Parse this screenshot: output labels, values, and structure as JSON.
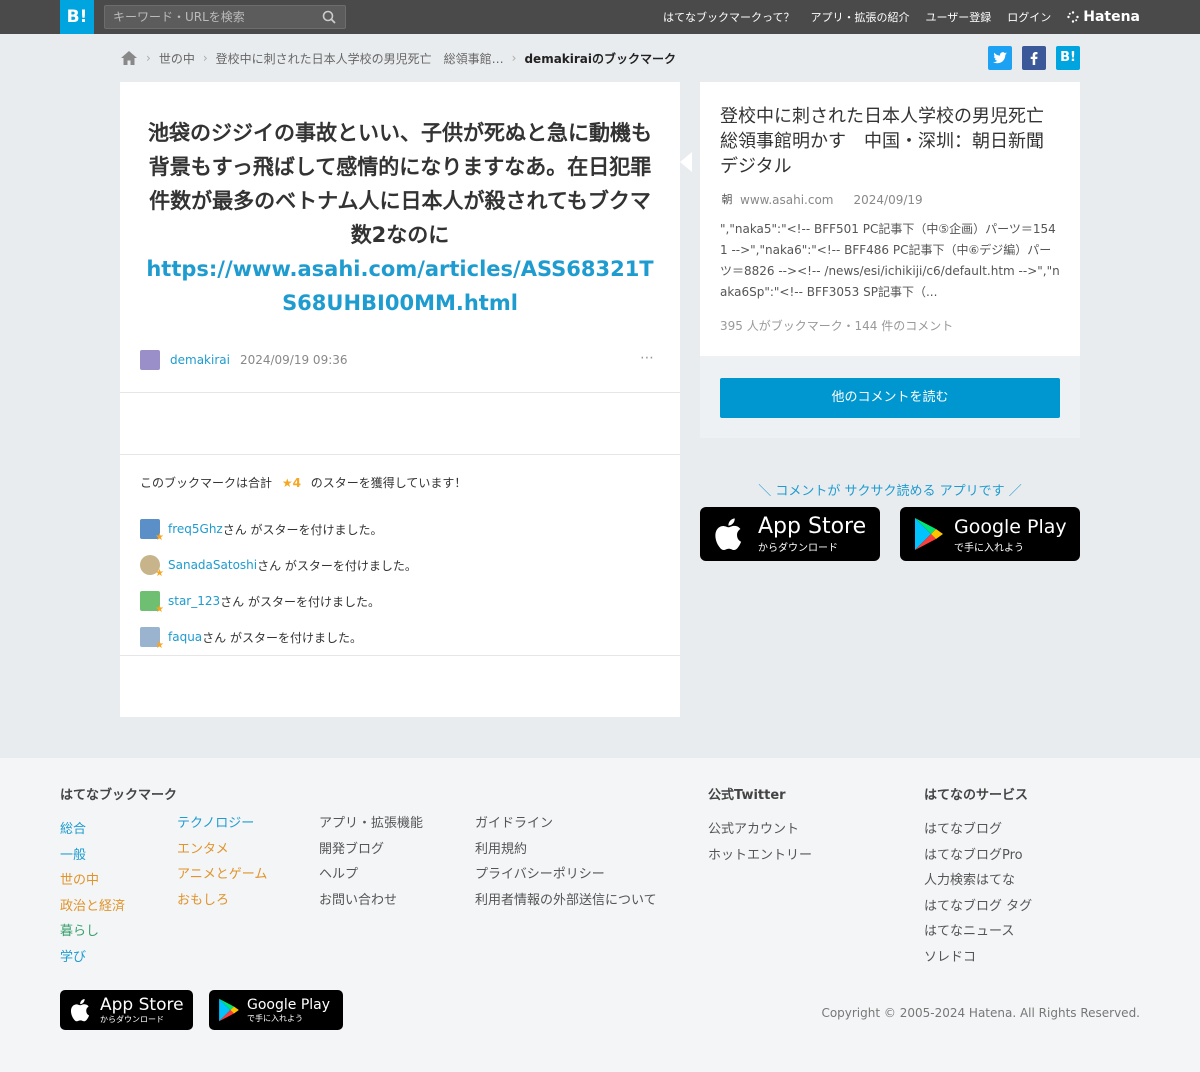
{
  "topbar": {
    "logo": "B!",
    "search_placeholder": "キーワード・URLを検索",
    "nav": [
      "はてなブックマークって？",
      "アプリ・拡張の紹介",
      "ユーザー登録",
      "ログイン"
    ],
    "brand": "Hatena"
  },
  "breadcrumb": {
    "items": [
      "世の中",
      "登校中に刺された日本人学校の男児死亡　総領事館…",
      "demakiraiのブックマーク"
    ]
  },
  "share": {
    "twitter": "t",
    "facebook": "f",
    "hatena": "B!"
  },
  "bookmark": {
    "comment": "池袋のジジイの事故といい、子供が死ぬと急に動機も背景もすっ飛ばして感情的になりますなあ。在日犯罪件数が最多のベトナム人に日本人が殺されてもブクマ数2なのに",
    "link": "https://www.asahi.com/articles/ASS68321TS68UHBI00MM.html",
    "user": "demakirai",
    "date": "2024/09/19 09:36",
    "more": "⋯"
  },
  "stars": {
    "head_prefix": "このブックマークは合計",
    "count": "★4",
    "head_suffix": "のスターを獲得しています！",
    "suffix": "さん がスターを付けました。",
    "users": [
      {
        "name": "freq5Ghz",
        "color": "#5a8fc7"
      },
      {
        "name": "SanadaSatoshi",
        "color": "#c8b48a"
      },
      {
        "name": "star_123",
        "color": "#6fbf73"
      },
      {
        "name": "faqua",
        "color": "#9ab3cf"
      }
    ]
  },
  "entry": {
    "title": "登校中に刺された日本人学校の男児死亡　総領事館明かす　中国・深圳：朝日新聞デジタル",
    "site_icon": "朝",
    "site": "www.asahi.com",
    "date": "2024/09/19",
    "desc": "\",\"naka5\":\"<!-- BFF501 PC記事下（中⑤企画）パーツ＝1541 -->\",\"naka6\":\"<!-- BFF486 PC記事下（中⑥デジ編）パーツ＝8826 --><!-- /news/esi/ichikiji/c6/default.htm -->\",\"naka6Sp\":\"<!-- BFF3053 SP記事下（...",
    "count": "395 人がブックマーク・144 件のコメント",
    "more_button": "他のコメントを読む"
  },
  "promo": {
    "text": "＼ コメントが サクサク読める アプリです ／",
    "appstore_big": "App Store",
    "appstore_sm": "からダウンロード",
    "googleplay_big": "Google Play",
    "googleplay_sm": "で手に入れよう"
  },
  "footer": {
    "col1_title": "はてなブックマーク",
    "col1a": [
      "総合",
      "一般",
      "世の中",
      "政治と経済",
      "暮らし",
      "学び"
    ],
    "col1b": [
      "テクノロジー",
      "エンタメ",
      "アニメとゲーム",
      "おもしろ"
    ],
    "col2": [
      "アプリ・拡張機能",
      "開発ブログ",
      "ヘルプ",
      "お問い合わせ"
    ],
    "col3": [
      "ガイドライン",
      "利用規約",
      "プライバシーポリシー",
      "利用者情報の外部送信について"
    ],
    "col4_title": "公式Twitter",
    "col4": [
      "公式アカウント",
      "ホットエントリー"
    ],
    "col5_title": "はてなのサービス",
    "col5": [
      "はてなブログ",
      "はてなブログPro",
      "人力検索はてな",
      "はてなブログ タグ",
      "はてなニュース",
      "ソレドコ"
    ],
    "copyright": "Copyright © 2005-2024 Hatena. All Rights Reserved."
  }
}
